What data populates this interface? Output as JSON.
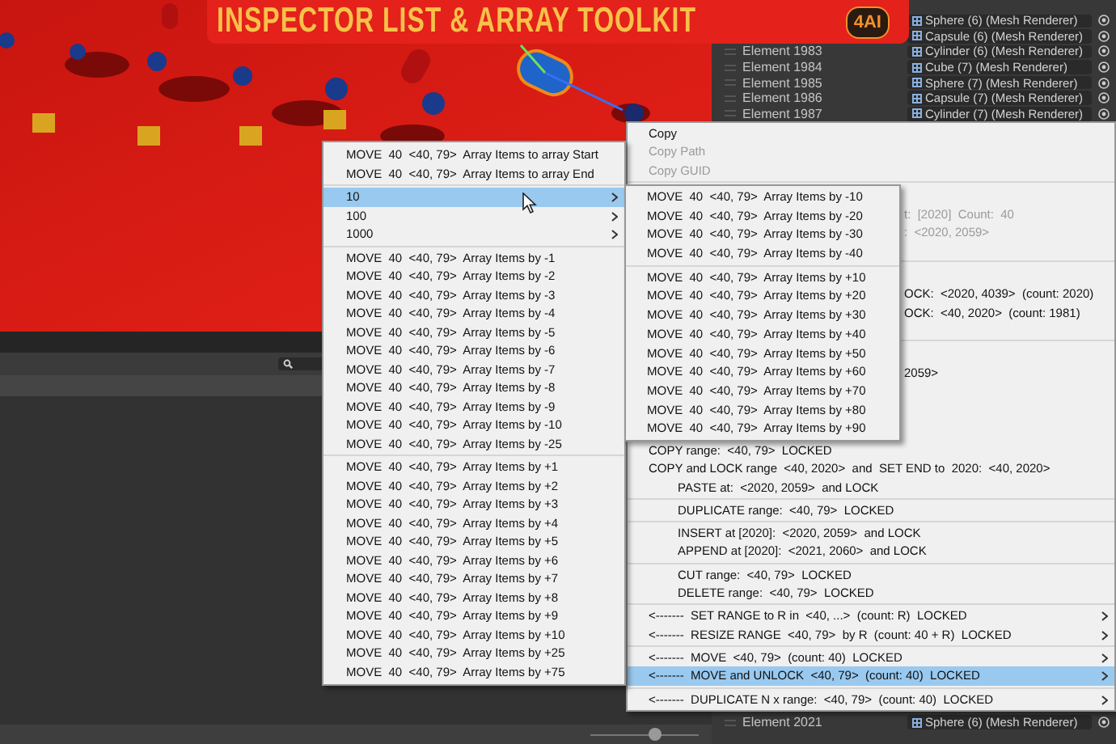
{
  "banner": {
    "title": "INSPECTOR LIST & ARRAY TOOLKIT",
    "logo": "4AI"
  },
  "inspector": {
    "rows_above_menu": [
      {
        "object": "Sphere (6) (Mesh Renderer)"
      },
      {
        "object": "Capsule (6) (Mesh Renderer)"
      },
      {
        "element": "Element 1983",
        "object": "Cylinder (6) (Mesh Renderer)"
      },
      {
        "element": "Element 1984",
        "object": "Cube (7) (Mesh Renderer)"
      },
      {
        "element": "Element 1985",
        "object": "Sphere (7) (Mesh Renderer)"
      },
      {
        "element": "Element 1986",
        "object": "Capsule (7) (Mesh Renderer)"
      },
      {
        "element": "Element 1987",
        "object": "Cylinder (7) (Mesh Renderer)"
      }
    ],
    "rows_below_menu": [
      {
        "element": "Element 2021",
        "object": "Sphere (6) (Mesh Renderer)"
      }
    ]
  },
  "zoom_slider": {
    "level": 0.6
  },
  "context_menu": {
    "groups_behind_submenu": [
      [
        {
          "label": "Copy",
          "kind": "item",
          "selected": false,
          "disabled": false,
          "has_submenu": false
        },
        {
          "label": "Copy Path",
          "kind": "item",
          "selected": false,
          "disabled": true,
          "has_submenu": false
        },
        {
          "label": "Copy GUID",
          "kind": "item",
          "selected": false,
          "disabled": true,
          "has_submenu": false
        }
      ],
      [
        {
          "label": "t:  [2020]  Count:  40",
          "kind": "partial",
          "selected": false,
          "disabled": true,
          "has_submenu": false
        },
        {
          "label": ":  <2020, 2059>",
          "kind": "partial",
          "selected": false,
          "disabled": true,
          "has_submenu": false
        }
      ],
      [
        {
          "label": "OCK:  <2020, 4039>  (count: 2020)",
          "kind": "partial",
          "selected": false,
          "disabled": false,
          "has_submenu": false
        },
        {
          "label": "OCK:  <40, 2020>  (count: 1981)",
          "kind": "partial",
          "selected": false,
          "disabled": false,
          "has_submenu": false
        }
      ],
      [
        {
          "label": "2059>",
          "kind": "partial",
          "selected": false,
          "disabled": false,
          "has_submenu": false
        }
      ]
    ],
    "groups_below_submenu": [
      [
        {
          "label": "COPY range:  <40, 79>  LOCKED",
          "kind": "item",
          "selected": false,
          "disabled": false,
          "has_submenu": false
        },
        {
          "label": "COPY and LOCK range  <40, 2020>  and  SET END to  2020:  <40, 2020>",
          "kind": "item",
          "selected": false,
          "disabled": false,
          "has_submenu": false
        },
        {
          "label": "PASTE at:  <2020, 2059>  and LOCK",
          "kind": "indented",
          "selected": false,
          "disabled": false,
          "has_submenu": false
        }
      ],
      [
        {
          "label": "DUPLICATE range:  <40, 79>  LOCKED",
          "kind": "indented",
          "selected": false,
          "disabled": false,
          "has_submenu": false
        }
      ],
      [
        {
          "label": "INSERT at [2020]:  <2020, 2059>  and LOCK",
          "kind": "indented",
          "selected": false,
          "disabled": false,
          "has_submenu": false
        },
        {
          "label": "APPEND at [2020]:  <2021, 2060>  and LOCK",
          "kind": "indented",
          "selected": false,
          "disabled": false,
          "has_submenu": false
        }
      ],
      [
        {
          "label": "CUT range:  <40, 79>  LOCKED",
          "kind": "indented",
          "selected": false,
          "disabled": false,
          "has_submenu": false
        },
        {
          "label": "DELETE range:  <40, 79>  LOCKED",
          "kind": "indented",
          "selected": false,
          "disabled": false,
          "has_submenu": false
        }
      ],
      [
        {
          "label": "<-------  SET RANGE to R in  <40, ...>  (count: R)  LOCKED",
          "kind": "item",
          "selected": false,
          "disabled": false,
          "has_submenu": true
        },
        {
          "label": "<-------  RESIZE RANGE  <40, 79>  by R  (count: 40 + R)  LOCKED",
          "kind": "item",
          "selected": false,
          "disabled": false,
          "has_submenu": true
        }
      ],
      [
        {
          "label": "<-------  MOVE  <40, 79>  (count: 40)  LOCKED",
          "kind": "item",
          "selected": false,
          "disabled": false,
          "has_submenu": true
        },
        {
          "label": "<-------  MOVE and UNLOCK  <40, 79>  (count: 40)  LOCKED",
          "kind": "item",
          "selected": true,
          "disabled": false,
          "has_submenu": true
        }
      ],
      [
        {
          "label": "<-------  DUPLICATE N x range:  <40, 79>  (count: 40)  LOCKED",
          "kind": "item",
          "selected": false,
          "disabled": false,
          "has_submenu": true
        }
      ]
    ]
  },
  "move_submenu": {
    "groups": [
      [
        {
          "label": "MOVE  40  <40, 79>  Array Items to array Start",
          "selected": false,
          "has_submenu": false
        },
        {
          "label": "MOVE  40  <40, 79>  Array Items to array End",
          "selected": false,
          "has_submenu": false
        }
      ],
      [
        {
          "label": "10",
          "selected": true,
          "has_submenu": true
        },
        {
          "label": "100",
          "selected": false,
          "has_submenu": true
        },
        {
          "label": "1000",
          "selected": false,
          "has_submenu": true
        }
      ],
      [
        {
          "label": "MOVE  40  <40, 79>  Array Items by -1",
          "selected": false,
          "has_submenu": false
        },
        {
          "label": "MOVE  40  <40, 79>  Array Items by -2",
          "selected": false,
          "has_submenu": false
        },
        {
          "label": "MOVE  40  <40, 79>  Array Items by -3",
          "selected": false,
          "has_submenu": false
        },
        {
          "label": "MOVE  40  <40, 79>  Array Items by -4",
          "selected": false,
          "has_submenu": false
        },
        {
          "label": "MOVE  40  <40, 79>  Array Items by -5",
          "selected": false,
          "has_submenu": false
        },
        {
          "label": "MOVE  40  <40, 79>  Array Items by -6",
          "selected": false,
          "has_submenu": false
        },
        {
          "label": "MOVE  40  <40, 79>  Array Items by -7",
          "selected": false,
          "has_submenu": false
        },
        {
          "label": "MOVE  40  <40, 79>  Array Items by -8",
          "selected": false,
          "has_submenu": false
        },
        {
          "label": "MOVE  40  <40, 79>  Array Items by -9",
          "selected": false,
          "has_submenu": false
        },
        {
          "label": "MOVE  40  <40, 79>  Array Items by -10",
          "selected": false,
          "has_submenu": false
        },
        {
          "label": "MOVE  40  <40, 79>  Array Items by -25",
          "selected": false,
          "has_submenu": false
        }
      ],
      [
        {
          "label": "MOVE  40  <40, 79>  Array Items by +1",
          "selected": false,
          "has_submenu": false
        },
        {
          "label": "MOVE  40  <40, 79>  Array Items by +2",
          "selected": false,
          "has_submenu": false
        },
        {
          "label": "MOVE  40  <40, 79>  Array Items by +3",
          "selected": false,
          "has_submenu": false
        },
        {
          "label": "MOVE  40  <40, 79>  Array Items by +4",
          "selected": false,
          "has_submenu": false
        },
        {
          "label": "MOVE  40  <40, 79>  Array Items by +5",
          "selected": false,
          "has_submenu": false
        },
        {
          "label": "MOVE  40  <40, 79>  Array Items by +6",
          "selected": false,
          "has_submenu": false
        },
        {
          "label": "MOVE  40  <40, 79>  Array Items by +7",
          "selected": false,
          "has_submenu": false
        },
        {
          "label": "MOVE  40  <40, 79>  Array Items by +8",
          "selected": false,
          "has_submenu": false
        },
        {
          "label": "MOVE  40  <40, 79>  Array Items by +9",
          "selected": false,
          "has_submenu": false
        },
        {
          "label": "MOVE  40  <40, 79>  Array Items by +10",
          "selected": false,
          "has_submenu": false
        },
        {
          "label": "MOVE  40  <40, 79>  Array Items by +25",
          "selected": false,
          "has_submenu": false
        },
        {
          "label": "MOVE  40  <40, 79>  Array Items by +75",
          "selected": false,
          "has_submenu": false
        }
      ]
    ]
  },
  "step_submenu": {
    "groups": [
      [
        {
          "label": "MOVE  40  <40, 79>  Array Items by -10",
          "selected": false
        },
        {
          "label": "MOVE  40  <40, 79>  Array Items by -20",
          "selected": false
        },
        {
          "label": "MOVE  40  <40, 79>  Array Items by -30",
          "selected": false
        },
        {
          "label": "MOVE  40  <40, 79>  Array Items by -40",
          "selected": false
        }
      ],
      [
        {
          "label": "MOVE  40  <40, 79>  Array Items by +10",
          "selected": false
        },
        {
          "label": "MOVE  40  <40, 79>  Array Items by +20",
          "selected": false
        },
        {
          "label": "MOVE  40  <40, 79>  Array Items by +30",
          "selected": false
        },
        {
          "label": "MOVE  40  <40, 79>  Array Items by +40",
          "selected": false
        },
        {
          "label": "MOVE  40  <40, 79>  Array Items by +50",
          "selected": false
        },
        {
          "label": "MOVE  40  <40, 79>  Array Items by +60",
          "selected": false
        },
        {
          "label": "MOVE  40  <40, 79>  Array Items by +70",
          "selected": false
        },
        {
          "label": "MOVE  40  <40, 79>  Array Items by +80",
          "selected": false
        },
        {
          "label": "MOVE  40  <40, 79>  Array Items by +90",
          "selected": false
        }
      ]
    ]
  }
}
